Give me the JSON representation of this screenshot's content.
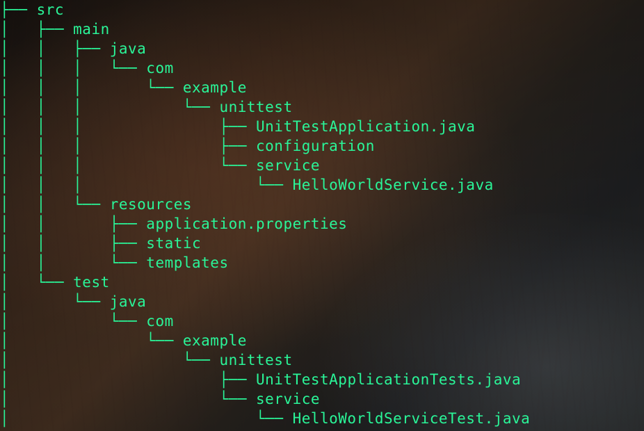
{
  "color": "#2af598",
  "tree": {
    "lines": [
      {
        "prefix": "├── ",
        "name": "src"
      },
      {
        "prefix": "│   ├── ",
        "name": "main"
      },
      {
        "prefix": "│   │   ├── ",
        "name": "java"
      },
      {
        "prefix": "│   │   │   └── ",
        "name": "com"
      },
      {
        "prefix": "│   │   │       └── ",
        "name": "example"
      },
      {
        "prefix": "│   │   │           └── ",
        "name": "unittest"
      },
      {
        "prefix": "│   │   │               ├── ",
        "name": "UnitTestApplication.java"
      },
      {
        "prefix": "│   │   │               ├── ",
        "name": "configuration"
      },
      {
        "prefix": "│   │   │               └── ",
        "name": "service"
      },
      {
        "prefix": "│   │   │                   └── ",
        "name": "HelloWorldService.java"
      },
      {
        "prefix": "│   │   └── ",
        "name": "resources"
      },
      {
        "prefix": "│   │       ├── ",
        "name": "application.properties"
      },
      {
        "prefix": "│   │       ├── ",
        "name": "static"
      },
      {
        "prefix": "│   │       └── ",
        "name": "templates"
      },
      {
        "prefix": "│   └── ",
        "name": "test"
      },
      {
        "prefix": "│       └── ",
        "name": "java"
      },
      {
        "prefix": "│           └── ",
        "name": "com"
      },
      {
        "prefix": "│               └── ",
        "name": "example"
      },
      {
        "prefix": "│                   └── ",
        "name": "unittest"
      },
      {
        "prefix": "│                       ├── ",
        "name": "UnitTestApplicationTests.java"
      },
      {
        "prefix": "│                       └── ",
        "name": "service"
      },
      {
        "prefix": "│                           └── ",
        "name": "HelloWorldServiceTest.java"
      }
    ]
  }
}
